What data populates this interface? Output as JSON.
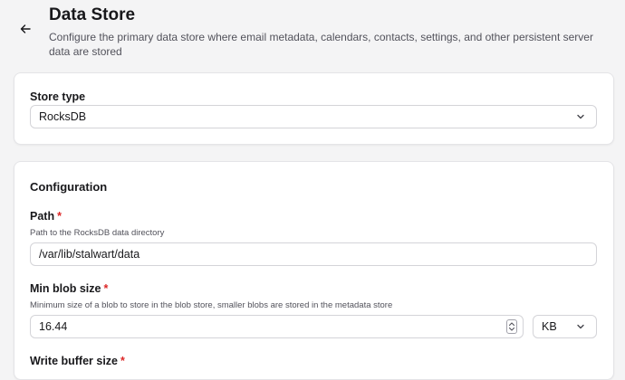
{
  "header": {
    "title": "Data Store",
    "subtitle": "Configure the primary data store where email metadata, calendars, contacts, settings, and other persistent server data are stored"
  },
  "store_type": {
    "label": "Store type",
    "value": "RocksDB"
  },
  "configuration": {
    "title": "Configuration",
    "path": {
      "label": "Path",
      "required_mark": "*",
      "help": "Path to the RocksDB data directory",
      "value": "/var/lib/stalwart/data"
    },
    "min_blob_size": {
      "label": "Min blob size",
      "required_mark": "*",
      "help": "Minimum size of a blob to store in the blob store, smaller blobs are stored in the metadata store",
      "value": "16.44",
      "unit": "KB"
    },
    "write_buffer_size": {
      "label": "Write buffer size",
      "required_mark": "*"
    }
  },
  "icons": {
    "back": "arrow-left-icon",
    "select": "chevron-down-icon",
    "stepper": "up-down-stepper-icon"
  },
  "colors": {
    "background": "#f4f4f5",
    "card": "#ffffff",
    "border": "#e4e4e7",
    "required": "#dc2626",
    "muted_text": "#52525b"
  }
}
